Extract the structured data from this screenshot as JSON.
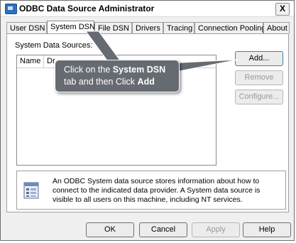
{
  "window": {
    "title": "ODBC Data Source Administrator",
    "close_glyph": "X"
  },
  "tabs": [
    {
      "label": "User DSN",
      "active": false
    },
    {
      "label": "System DSN",
      "active": true
    },
    {
      "label": "File DSN",
      "active": false
    },
    {
      "label": "Drivers",
      "active": false
    },
    {
      "label": "Tracing",
      "active": false
    },
    {
      "label": "Connection Pooling",
      "active": false
    },
    {
      "label": "About",
      "active": false
    }
  ],
  "system_dsn": {
    "list_label": "System Data Sources:",
    "columns": [
      "Name",
      "Dr"
    ],
    "buttons": {
      "add": "Add...",
      "remove": "Remove",
      "configure": "Configure..."
    },
    "info_text": "An ODBC System data source stores information about how to connect to the indicated data provider.  A System data source is visible to all users on this machine, including NT services."
  },
  "callout": {
    "line1_prefix": "Click on the ",
    "line1_bold": "System DSN",
    "line2_prefix": "tab and then Click ",
    "line2_bold": "Add"
  },
  "footer_buttons": {
    "ok": "OK",
    "cancel": "Cancel",
    "apply": "Apply",
    "help": "Help"
  },
  "colors": {
    "callout_bg": "#666b72",
    "window_bg": "#f0f0f0",
    "disabled_text": "#9a9a9a"
  }
}
